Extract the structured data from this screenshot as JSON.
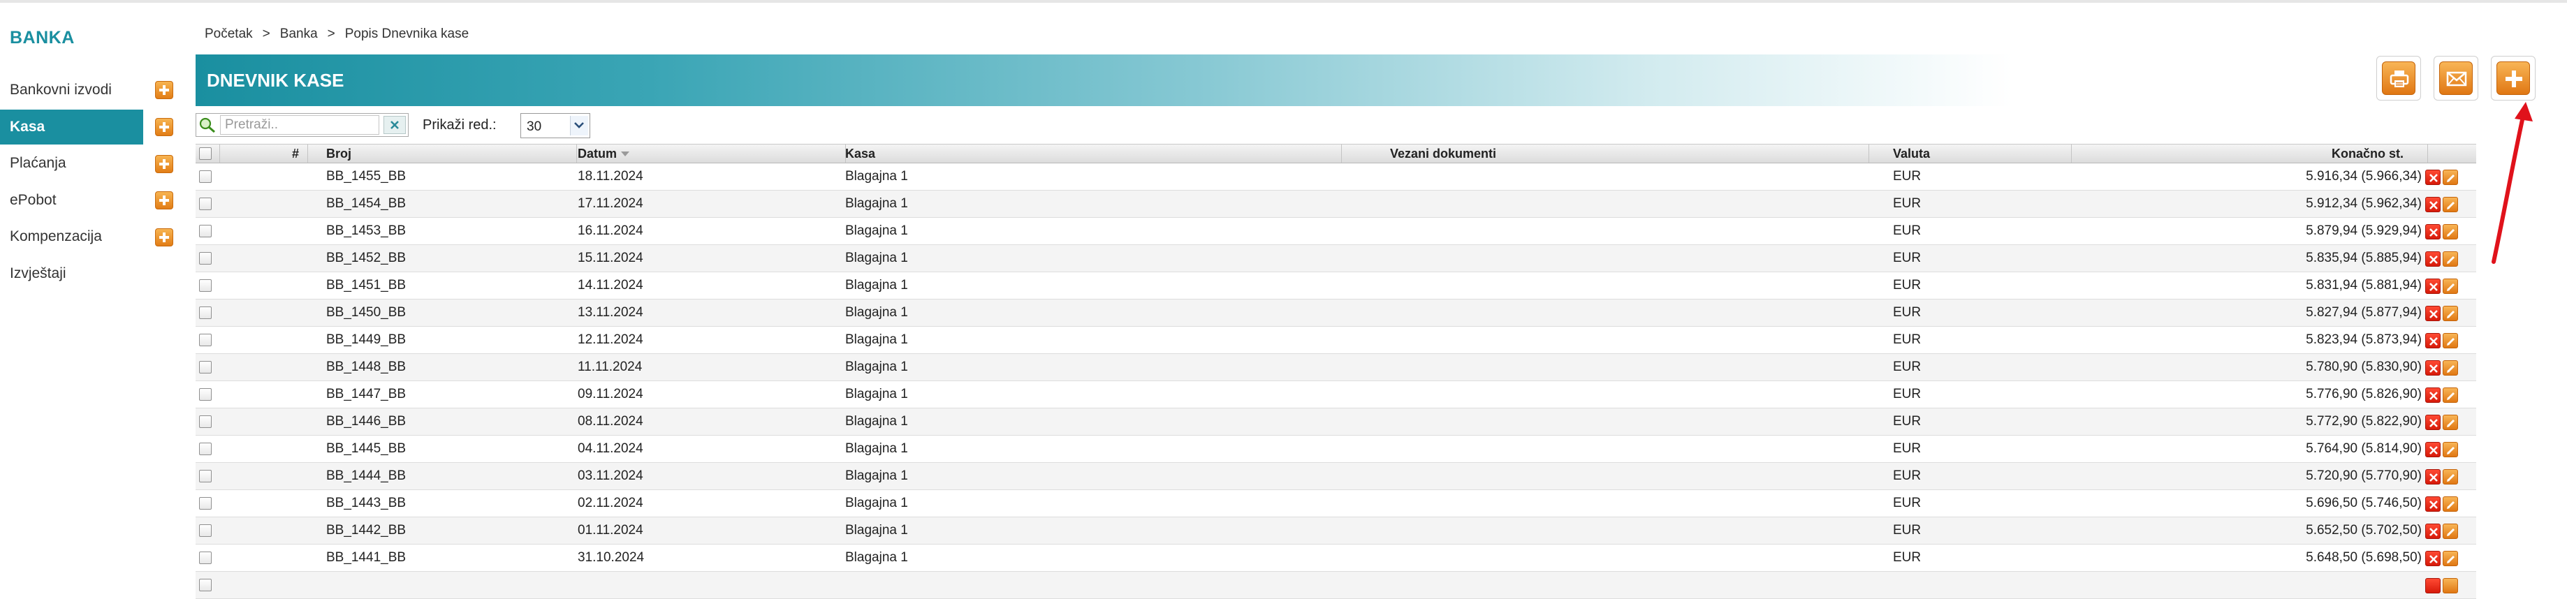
{
  "sidebar": {
    "brand": "BANKA",
    "items": [
      {
        "label": "Bankovni izvodi",
        "has_add": true,
        "active": false
      },
      {
        "label": "Kasa",
        "has_add": true,
        "active": true
      },
      {
        "label": "Plaćanja",
        "has_add": true,
        "active": false
      },
      {
        "label": "ePobot",
        "has_add": true,
        "active": false
      },
      {
        "label": "Kompenzacija",
        "has_add": true,
        "active": false
      },
      {
        "label": "Izvještaji",
        "has_add": false,
        "active": false
      }
    ]
  },
  "breadcrumb": [
    "Početak",
    "Banka",
    "Popis Dnevnika kase"
  ],
  "breadcrumb_separator": ">",
  "page_title": "DNEVNIK KASE",
  "toolbar": {
    "buttons": [
      {
        "icon": "printer-icon",
        "name": "print-button"
      },
      {
        "icon": "mail-icon",
        "name": "email-button"
      },
      {
        "icon": "plus-icon",
        "name": "add-button"
      }
    ]
  },
  "search": {
    "placeholder": "Pretraži..",
    "value": ""
  },
  "rows_per_page": {
    "label": "Prikaži red.:",
    "value": "30"
  },
  "table": {
    "columns": [
      "#",
      "Broj",
      "Datum",
      "Kasa",
      "Vezani dokumenti",
      "Valuta",
      "Konačno st."
    ],
    "rows": [
      {
        "broj": "BB_1455_BB",
        "datum": "18.11.2024",
        "kasa": "Blagajna 1",
        "vezani": "",
        "valuta": "EUR",
        "stanje": "5.916,34 (5.966,34)"
      },
      {
        "broj": "BB_1454_BB",
        "datum": "17.11.2024",
        "kasa": "Blagajna 1",
        "vezani": "",
        "valuta": "EUR",
        "stanje": "5.912,34 (5.962,34)"
      },
      {
        "broj": "BB_1453_BB",
        "datum": "16.11.2024",
        "kasa": "Blagajna 1",
        "vezani": "",
        "valuta": "EUR",
        "stanje": "5.879,94 (5.929,94)"
      },
      {
        "broj": "BB_1452_BB",
        "datum": "15.11.2024",
        "kasa": "Blagajna 1",
        "vezani": "",
        "valuta": "EUR",
        "stanje": "5.835,94 (5.885,94)"
      },
      {
        "broj": "BB_1451_BB",
        "datum": "14.11.2024",
        "kasa": "Blagajna 1",
        "vezani": "",
        "valuta": "EUR",
        "stanje": "5.831,94 (5.881,94)"
      },
      {
        "broj": "BB_1450_BB",
        "datum": "13.11.2024",
        "kasa": "Blagajna 1",
        "vezani": "",
        "valuta": "EUR",
        "stanje": "5.827,94 (5.877,94)"
      },
      {
        "broj": "BB_1449_BB",
        "datum": "12.11.2024",
        "kasa": "Blagajna 1",
        "vezani": "",
        "valuta": "EUR",
        "stanje": "5.823,94 (5.873,94)"
      },
      {
        "broj": "BB_1448_BB",
        "datum": "11.11.2024",
        "kasa": "Blagajna 1",
        "vezani": "",
        "valuta": "EUR",
        "stanje": "5.780,90 (5.830,90)"
      },
      {
        "broj": "BB_1447_BB",
        "datum": "09.11.2024",
        "kasa": "Blagajna 1",
        "vezani": "",
        "valuta": "EUR",
        "stanje": "5.776,90 (5.826,90)"
      },
      {
        "broj": "BB_1446_BB",
        "datum": "08.11.2024",
        "kasa": "Blagajna 1",
        "vezani": "",
        "valuta": "EUR",
        "stanje": "5.772,90 (5.822,90)"
      },
      {
        "broj": "BB_1445_BB",
        "datum": "04.11.2024",
        "kasa": "Blagajna 1",
        "vezani": "",
        "valuta": "EUR",
        "stanje": "5.764,90 (5.814,90)"
      },
      {
        "broj": "BB_1444_BB",
        "datum": "03.11.2024",
        "kasa": "Blagajna 1",
        "vezani": "",
        "valuta": "EUR",
        "stanje": "5.720,90 (5.770,90)"
      },
      {
        "broj": "BB_1443_BB",
        "datum": "02.11.2024",
        "kasa": "Blagajna 1",
        "vezani": "",
        "valuta": "EUR",
        "stanje": "5.696,50 (5.746,50)"
      },
      {
        "broj": "BB_1442_BB",
        "datum": "01.11.2024",
        "kasa": "Blagajna 1",
        "vezani": "",
        "valuta": "EUR",
        "stanje": "5.652,50 (5.702,50)"
      },
      {
        "broj": "BB_1441_BB",
        "datum": "31.10.2024",
        "kasa": "Blagajna 1",
        "vezani": "",
        "valuta": "EUR",
        "stanje": "5.648,50 (5.698,50)"
      }
    ]
  },
  "colors": {
    "accent": "#1a8fa0",
    "button_orange": "#e07713",
    "delete_red": "#d71a0a",
    "annotation_red": "#e0121b"
  }
}
